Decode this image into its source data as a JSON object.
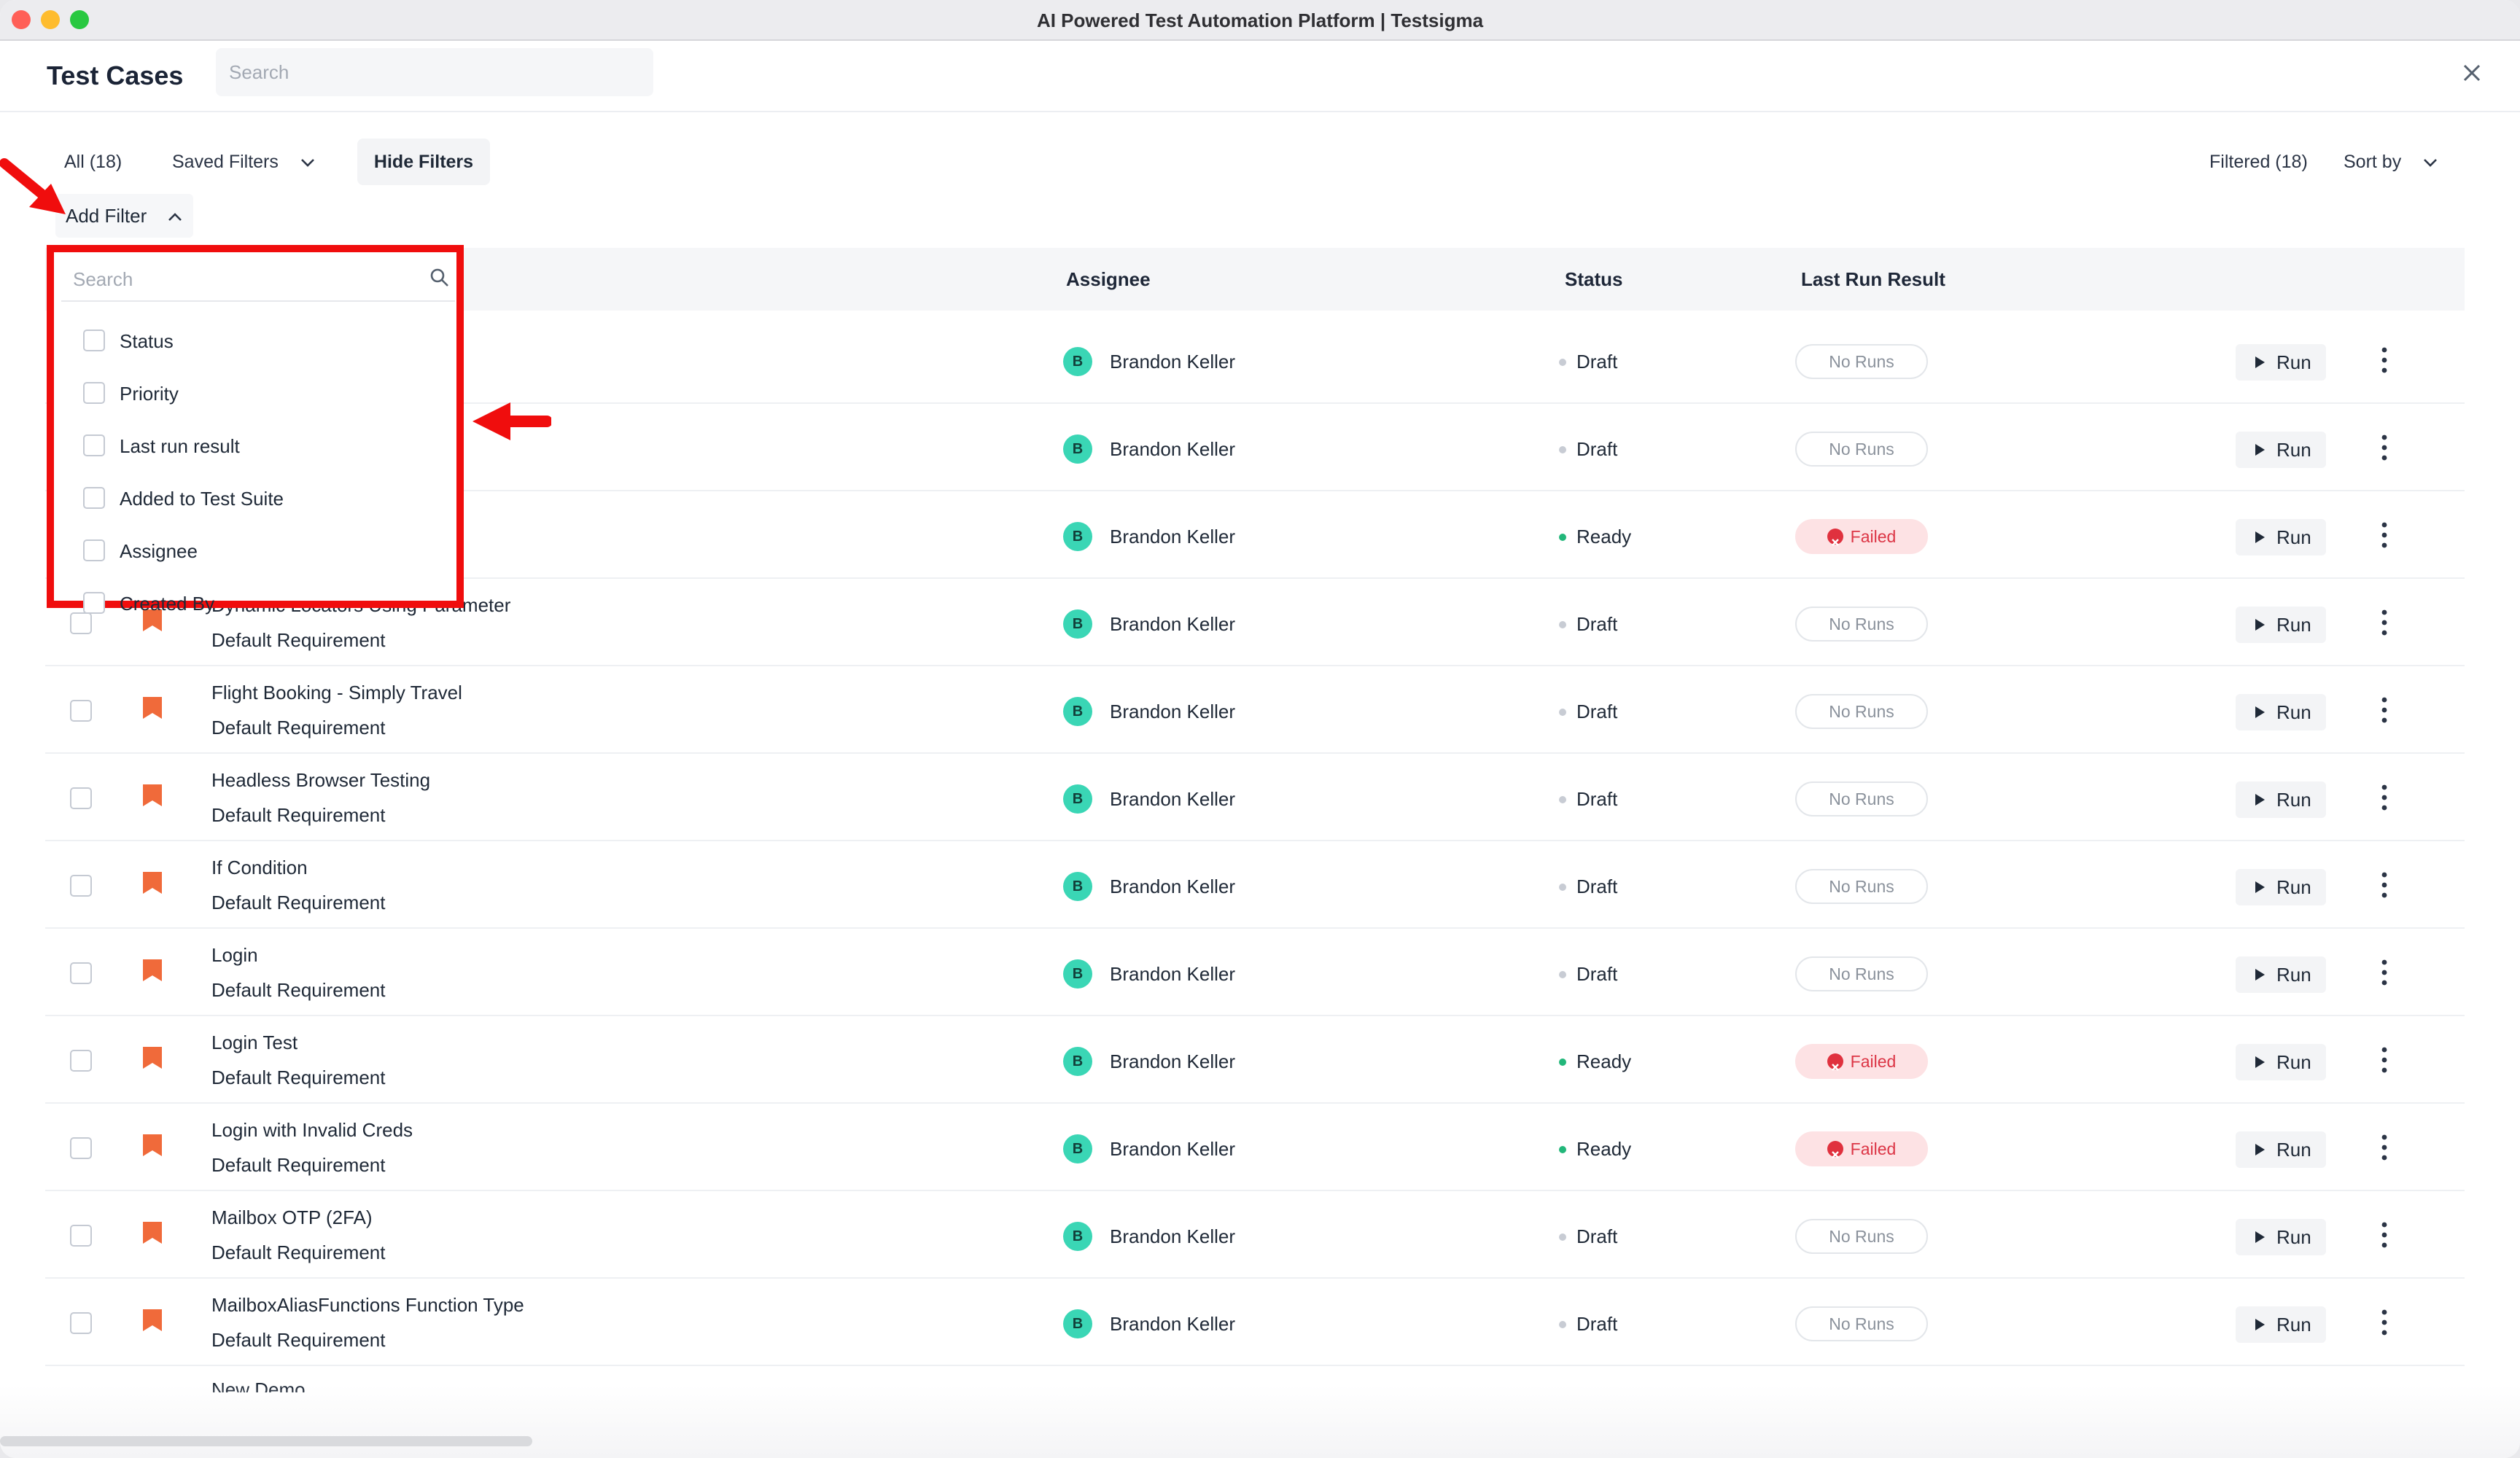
{
  "window": {
    "title": "AI Powered Test Automation Platform | Testsigma"
  },
  "header": {
    "title": "Test Cases",
    "search_placeholder": "Search"
  },
  "filterbar": {
    "all_label": "All (18)",
    "saved_filters_label": "Saved Filters",
    "hide_filters_label": "Hide Filters",
    "filtered_label": "Filtered (18)",
    "sort_label": "Sort by",
    "add_filter_label": "Add Filter"
  },
  "table": {
    "columns": {
      "assignee": "Assignee",
      "status": "Status",
      "result": "Last Run Result"
    },
    "run_label": "Run",
    "rows": [
      {
        "name": "",
        "requirement": "",
        "assignee_initial": "B",
        "assignee": "Brandon Keller",
        "status": "Draft",
        "result": "No Runs"
      },
      {
        "name": "",
        "requirement": "",
        "assignee_initial": "B",
        "assignee": "Brandon Keller",
        "status": "Draft",
        "result": "No Runs"
      },
      {
        "name": "",
        "requirement": "",
        "assignee_initial": "B",
        "assignee": "Brandon Keller",
        "status": "Ready",
        "result": "Failed"
      },
      {
        "name": "Dynamic Locators Using Parameter",
        "requirement": "Default Requirement",
        "assignee_initial": "B",
        "assignee": "Brandon Keller",
        "status": "Draft",
        "result": "No Runs"
      },
      {
        "name": "Flight Booking - Simply Travel",
        "requirement": "Default Requirement",
        "assignee_initial": "B",
        "assignee": "Brandon Keller",
        "status": "Draft",
        "result": "No Runs"
      },
      {
        "name": "Headless Browser Testing",
        "requirement": "Default Requirement",
        "assignee_initial": "B",
        "assignee": "Brandon Keller",
        "status": "Draft",
        "result": "No Runs"
      },
      {
        "name": "If Condition",
        "requirement": "Default Requirement",
        "assignee_initial": "B",
        "assignee": "Brandon Keller",
        "status": "Draft",
        "result": "No Runs"
      },
      {
        "name": "Login",
        "requirement": "Default Requirement",
        "assignee_initial": "B",
        "assignee": "Brandon Keller",
        "status": "Draft",
        "result": "No Runs"
      },
      {
        "name": "Login Test",
        "requirement": "Default Requirement",
        "assignee_initial": "B",
        "assignee": "Brandon Keller",
        "status": "Ready",
        "result": "Failed"
      },
      {
        "name": "Login with Invalid Creds",
        "requirement": "Default Requirement",
        "assignee_initial": "B",
        "assignee": "Brandon Keller",
        "status": "Ready",
        "result": "Failed"
      },
      {
        "name": "Mailbox OTP (2FA)",
        "requirement": "Default Requirement",
        "assignee_initial": "B",
        "assignee": "Brandon Keller",
        "status": "Draft",
        "result": "No Runs"
      },
      {
        "name": "MailboxAliasFunctions Function Type",
        "requirement": "Default Requirement",
        "assignee_initial": "B",
        "assignee": "Brandon Keller",
        "status": "Draft",
        "result": "No Runs"
      }
    ],
    "partial_row_name": "New Demo"
  },
  "dropdown": {
    "search_placeholder": "Search",
    "options": [
      "Status",
      "Priority",
      "Last run result",
      "Added to Test Suite",
      "Assignee",
      "Created By"
    ]
  },
  "colors": {
    "highlight": "#f00d0d",
    "avatar": "#3ad6b5",
    "ready": "#22b77a",
    "failed": "#dc3545",
    "priority": "#f06a3a"
  },
  "icons": [
    "search-icon",
    "close-icon",
    "chevron-down-icon",
    "chevron-up-icon",
    "priority-flag-icon",
    "play-icon",
    "kebab-menu-icon",
    "failed-icon",
    "annotation-arrow"
  ]
}
